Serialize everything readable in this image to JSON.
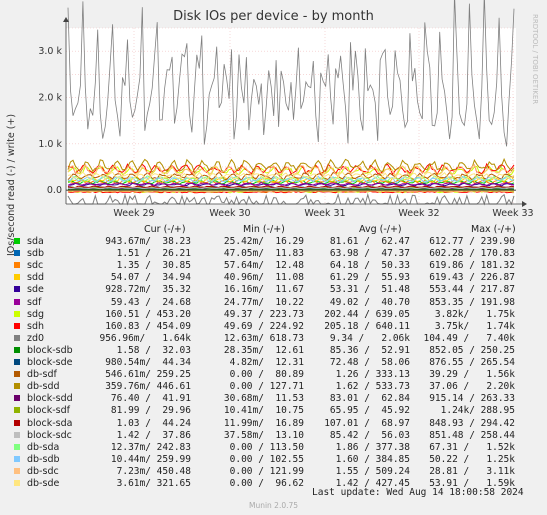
{
  "chart_data": {
    "type": "line",
    "title": "Disk IOs per device - by month",
    "ylabel": "IOs/second read (-) / write (+)",
    "watermark": "RRDTOOL / TOBI OETIKER",
    "yticks": [
      "3.5 k",
      "3.0 k",
      "2.5 k",
      "2.0 k",
      "1.5 k",
      "1.0 k",
      "0.5 k",
      "0.0",
      "-0.5 k"
    ],
    "ytick_labels": [
      "3.0 k",
      "2.0 k",
      "1.0 k",
      "0.0"
    ],
    "ylim": [
      -300,
      3500
    ],
    "xticks": [
      "Week 29",
      "Week 30",
      "Week 31",
      "Week 32",
      "Week 33"
    ],
    "grid": true,
    "series": [
      {
        "name": "sda",
        "color": "#00cc00",
        "level": 170,
        "amp": 40
      },
      {
        "name": "sdb",
        "color": "#0066b3",
        "level": 60,
        "amp": 20
      },
      {
        "name": "sdc",
        "color": "#ff8000",
        "level": 180,
        "amp": 45
      },
      {
        "name": "sdd",
        "color": "#ffcc00",
        "level": 230,
        "amp": 60
      },
      {
        "name": "sde",
        "color": "#330099",
        "level": 120,
        "amp": 30
      },
      {
        "name": "sdf",
        "color": "#990099",
        "level": 130,
        "amp": 35
      },
      {
        "name": "sdg",
        "color": "#ccff00",
        "level": 420,
        "amp": 110
      },
      {
        "name": "sdh",
        "color": "#ff0000",
        "level": 450,
        "amp": 120
      },
      {
        "name": "zd0",
        "color": "#808080",
        "level": 2000,
        "amp": 1100
      },
      {
        "name": "block-sdb",
        "color": "#008f00",
        "level": 20,
        "amp": 8
      },
      {
        "name": "block-sde",
        "color": "#00487d",
        "level": 40,
        "amp": 10
      },
      {
        "name": "db-sdf",
        "color": "#b35a00",
        "level": 300,
        "amp": 90
      },
      {
        "name": "db-sdd",
        "color": "#b38f00",
        "level": 520,
        "amp": 150
      },
      {
        "name": "block-sdd",
        "color": "#6b006b",
        "level": 50,
        "amp": 15
      },
      {
        "name": "block-sdf",
        "color": "#8fb300",
        "level": 60,
        "amp": 15
      },
      {
        "name": "block-sda",
        "color": "#b30000",
        "level": 70,
        "amp": 20
      },
      {
        "name": "block-sdc",
        "color": "#bebebe",
        "level": 45,
        "amp": 12
      },
      {
        "name": "db-sda",
        "color": "#80ff80",
        "level": 240,
        "amp": 70
      },
      {
        "name": "db-sdb",
        "color": "#80c9ff",
        "level": 230,
        "amp": 70
      },
      {
        "name": "db-sdc",
        "color": "#ffc080",
        "level": 420,
        "amp": 130
      },
      {
        "name": "db-sde",
        "color": "#ffe680",
        "level": 300,
        "amp": 90
      }
    ]
  },
  "legend": {
    "headers": {
      "cur": "Cur (-/+)",
      "min": "Min (-/+)",
      "avg": "Avg (-/+)",
      "max": "Max (-/+)"
    },
    "rows": [
      {
        "name": "sda",
        "cur": "943.67m/  38.23",
        "min": "25.42m/  16.29",
        "avg": "81.61 /  62.47",
        "max": "612.77 / 239.90"
      },
      {
        "name": "sdb",
        "cur": "1.51 /  26.21",
        "min": "47.05m/  11.83",
        "avg": "63.98 /  47.37",
        "max": "602.28 / 170.83"
      },
      {
        "name": "sdc",
        "cur": "1.35 /  30.85",
        "min": "57.64m/  12.48",
        "avg": "64.18 /  50.33",
        "max": "619.86 / 181.32"
      },
      {
        "name": "sdd",
        "cur": "54.07 /  34.94",
        "min": "40.96m/  11.08",
        "avg": "61.29 /  55.93",
        "max": "619.43 / 226.87"
      },
      {
        "name": "sde",
        "cur": "928.72m/  35.32",
        "min": "16.16m/  11.67",
        "avg": "53.31 /  51.48",
        "max": "553.44 / 217.87"
      },
      {
        "name": "sdf",
        "cur": "59.43 /  24.68",
        "min": "24.77m/  10.22",
        "avg": "49.02 /  40.70",
        "max": "853.35 / 191.98"
      },
      {
        "name": "sdg",
        "cur": "160.51 / 453.20",
        "min": "49.37 / 223.73",
        "avg": "202.44 / 639.05",
        "max": "3.82k/   1.75k"
      },
      {
        "name": "sdh",
        "cur": "160.83 / 454.09",
        "min": "49.69 / 224.92",
        "avg": "205.18 / 640.11",
        "max": "3.75k/   1.74k"
      },
      {
        "name": "zd0",
        "cur": "956.96m/   1.64k",
        "min": "12.63m/ 618.73",
        "avg": "9.34 /   2.06k",
        "max": "104.49 /   7.40k"
      },
      {
        "name": "block-sdb",
        "cur": "1.58 /  32.03",
        "min": "28.35m/  12.61",
        "avg": "85.36 /  52.91",
        "max": "852.05 / 250.25"
      },
      {
        "name": "block-sde",
        "cur": "980.54m/  44.34",
        "min": "4.82m/  12.31",
        "avg": "72.48 /  58.06",
        "max": "876.55 / 265.54"
      },
      {
        "name": "db-sdf",
        "cur": "546.61m/ 259.25",
        "min": "0.00 /  80.89",
        "avg": "1.26 / 333.13",
        "max": "39.29 /   1.56k"
      },
      {
        "name": "db-sdd",
        "cur": "359.76m/ 446.61",
        "min": "0.00 / 127.71",
        "avg": "1.62 / 533.73",
        "max": "37.06 /   2.20k"
      },
      {
        "name": "block-sdd",
        "cur": "76.40 /  41.91",
        "min": "30.68m/  11.53",
        "avg": "83.01 /  62.84",
        "max": "915.14 / 263.33"
      },
      {
        "name": "block-sdf",
        "cur": "81.99 /  29.96",
        "min": "10.41m/  10.75",
        "avg": "65.95 /  45.92",
        "max": "1.24k/ 288.95"
      },
      {
        "name": "block-sda",
        "cur": "1.03 /  44.24",
        "min": "11.99m/  16.89",
        "avg": "107.01 /  68.97",
        "max": "848.93 / 294.42"
      },
      {
        "name": "block-sdc",
        "cur": "1.42 /  37.86",
        "min": "37.58m/  13.10",
        "avg": "85.42 /  56.03",
        "max": "851.48 / 258.44"
      },
      {
        "name": "db-sda",
        "cur": "12.37m/ 242.83",
        "min": "0.00 / 113.50",
        "avg": "1.86 / 377.38",
        "max": "67.31 /   1.52k"
      },
      {
        "name": "db-sdb",
        "cur": "10.44m/ 259.99",
        "min": "0.00 / 102.55",
        "avg": "1.60 / 384.85",
        "max": "50.22 /   1.25k"
      },
      {
        "name": "db-sdc",
        "cur": "7.23m/ 450.48",
        "min": "0.00 / 121.99",
        "avg": "1.55 / 509.24",
        "max": "28.81 /   3.11k"
      },
      {
        "name": "db-sde",
        "cur": "3.61m/ 321.65",
        "min": "0.00 /  96.62",
        "avg": "1.42 / 427.45",
        "max": "53.91 /   1.59k"
      }
    ]
  },
  "footer": {
    "last_update": "Last update: Wed Aug 14 18:00:58 2024",
    "munin": "Munin 2.0.75"
  }
}
